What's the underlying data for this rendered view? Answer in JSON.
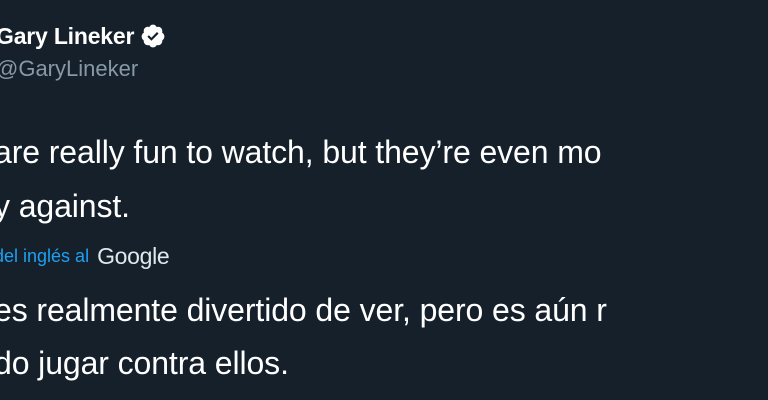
{
  "tweet": {
    "author_name": "Gary Lineker",
    "handle": "@GaryLineker",
    "lines": [
      "are really fun to watch, but they’re even mo",
      "y against."
    ],
    "translation_label": "del inglés al",
    "translation_provider": "Google",
    "translated_lines": [
      "es realmente divertido de ver, pero es aún r",
      "do jugar contra ellos."
    ],
    "verified_icon": "verified-badge-icon"
  },
  "colors": {
    "background": "#15202b",
    "text": "#ffffff",
    "secondary_text": "#8899a6",
    "link": "#1da1f2"
  }
}
